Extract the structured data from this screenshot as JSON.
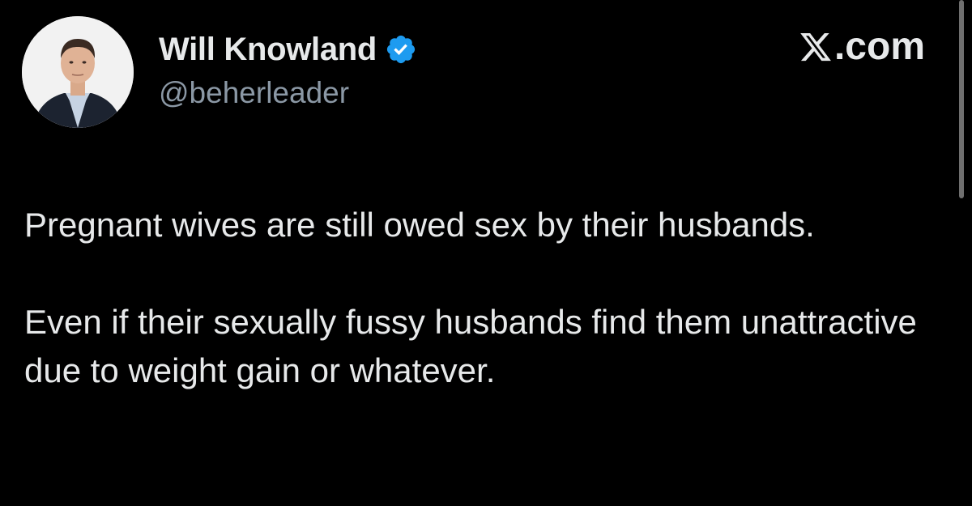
{
  "author": {
    "display_name": "Will Knowland",
    "handle": "@beherleader",
    "verified": true,
    "verified_color": "#1d9bf0"
  },
  "brand": {
    "label": ".com",
    "logo_icon": "x-logo-icon"
  },
  "tweet": {
    "paragraphs": [
      "Pregnant wives are still owed sex by their husbands.",
      "Even if their sexually fussy husbands find them unattractive due to weight gain or whatever."
    ]
  },
  "colors": {
    "background": "#000000",
    "text": "#e7e9ea",
    "handle": "#8b98a5"
  }
}
